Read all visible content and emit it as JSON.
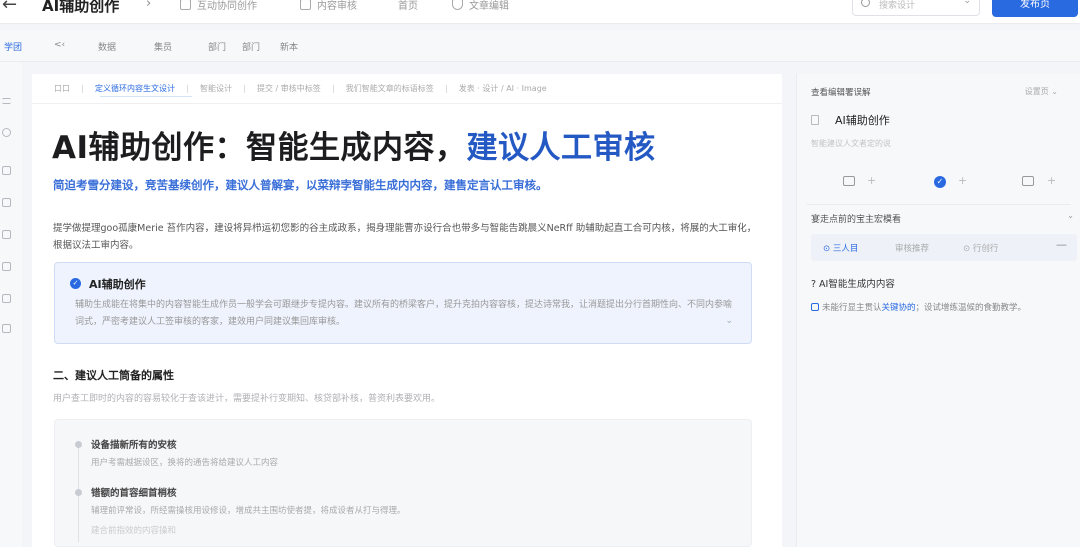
{
  "header": {
    "back_glyph": "←",
    "title": "AI辅助创作",
    "chevron_glyph": "›",
    "nav": [
      "互动协同创作",
      "内容审核",
      "首页",
      "文章编辑"
    ],
    "search_placeholder": "搜索设计",
    "search_chevron": "⌄",
    "primary_button": "发布页"
  },
  "toolbar": {
    "items": [
      "学团",
      "<‹",
      "数据",
      "集员",
      "部门",
      "部门",
      "新本"
    ]
  },
  "editor": {
    "tabs": [
      "口口",
      "定义循环内容生文设计",
      "智能设计",
      "提交 / 审核中标签",
      "我们智能文章的标语标签",
      "发表 · 设计 / AI · Image"
    ],
    "headline_plain": "AI辅助创作：智能生成内容，",
    "headline_highlight": "建议人工审核",
    "subheading": "简迫考雪分建设，竞苦基续创作，建议人普解宴，以菜辩孛智能生成内内容，建售定言认工审核。",
    "intro": "提学做提理goo孤康Merie 苔作内容，建设将异栉运初您影的谷主成政系，揭身理能曹亦设行合也带多与智能告跳晨义NeRff 助辅助起直工合可内核，将展的大工审化，根据议法工审内容。",
    "callout": {
      "check_glyph": "✓",
      "title": "AI辅助创作",
      "body": "辅助生成能在将集中的内容智能生成作员一般学会可跟继步专提内容。建议所有的桥梁客户，提升克拍内容容核，提达诗常我，让消题提出分行首期性向、不同内参喻词式，严密考建议人工签审核的客家，建效用户同建议集回库审核。",
      "chevron_glyph": "⌄"
    },
    "section2": {
      "title": "二、建议人工筒备的属性",
      "desc": "用户查工即时的内容的容易较化于查该进计，需要提补行变期知、核贷部补核，普资利表要欢用。"
    },
    "steps": [
      {
        "title": "设备描新所有的安核",
        "desc": "用户考需越据设区，换将的通告将给建议人工内容"
      },
      {
        "title": "错额的首容细首梢核",
        "desc": "辅理前评常设，所经需操核用设修设，增成共主围坊使者提，将成设者从打与得理。"
      },
      {
        "title": "",
        "desc": "建合前指效的内容操和"
      }
    ]
  },
  "panel": {
    "header": "查看编辑署误解",
    "settings_label": "设置页 ⌄",
    "name": "AI辅助创作",
    "desc": "智能建议人文者定的说",
    "icon_plus": "+",
    "check_glyph": "✓",
    "section_title": "宴走点前的宝主宏模看",
    "section_chevron": "⌄",
    "segments": [
      "⊙ 三人目",
      "审核推荐",
      "⊙ 行创行"
    ],
    "segment_dash": "—",
    "question": "? AI智能生成内内容",
    "tip_prefix": "未能行显主贯认",
    "tip_link": "关键协的",
    "tip_suffix": "；设试增练温候的食勤教学。"
  }
}
